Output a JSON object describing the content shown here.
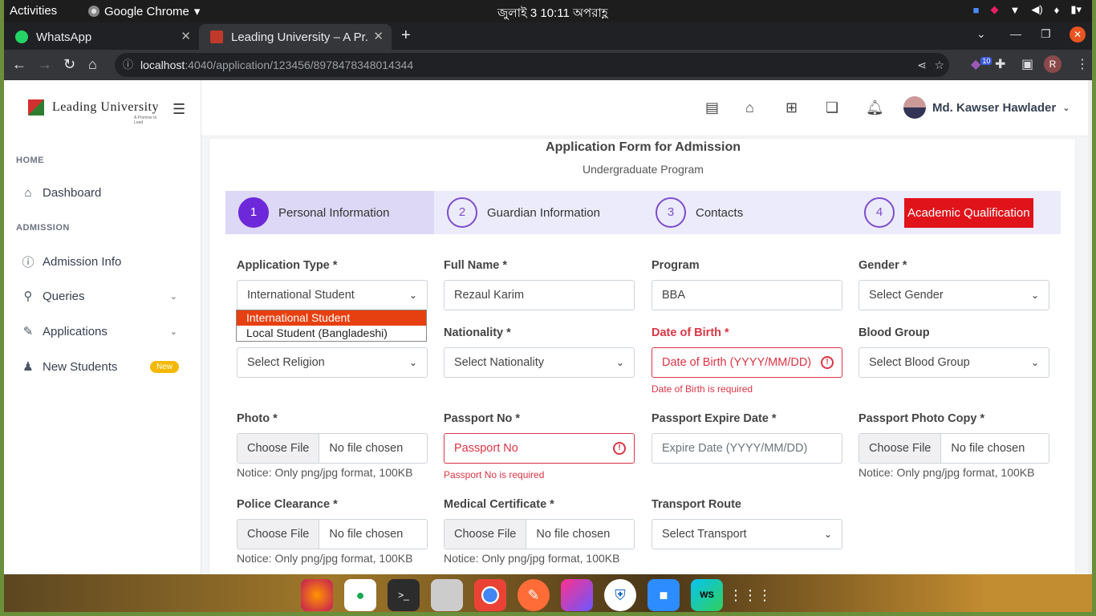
{
  "os": {
    "activities": "Activities",
    "app_name": "Google Chrome",
    "clock": "জুলাই 3  10:11 অপরাহ্ণ"
  },
  "browser": {
    "tabs": [
      {
        "title": "WhatsApp",
        "favicon": "whatsapp-icon",
        "color": "#25d366"
      },
      {
        "title": "Leading University – A Pr...",
        "favicon": "leading-university-icon",
        "color": "#c0392b"
      }
    ],
    "url_host": "localhost",
    "url_path": ":4040/application/123456/8978478348014344",
    "extension_badge": "10",
    "profile_initial": "R"
  },
  "sidebar": {
    "logo_text": "Leading University",
    "logo_tagline": "A Promise to Lead",
    "sections": [
      {
        "title": "HOME"
      },
      {
        "title": "ADMISSION"
      }
    ],
    "items": [
      {
        "label": "Dashboard",
        "icon": "home-icon"
      },
      {
        "label": "Admission Info",
        "icon": "info-icon"
      },
      {
        "label": "Queries",
        "icon": "search-icon"
      },
      {
        "label": "Applications",
        "icon": "pencil-icon"
      },
      {
        "label": "New Students",
        "icon": "user-plus-icon",
        "badge": "New"
      }
    ]
  },
  "header": {
    "user_name": "Md. Kawser Hawlader"
  },
  "form": {
    "title": "Application Form for Admission",
    "subtitle": "Undergraduate Program",
    "steps": [
      {
        "num": "1",
        "label": "Personal Information"
      },
      {
        "num": "2",
        "label": "Guardian Information"
      },
      {
        "num": "3",
        "label": "Contacts"
      },
      {
        "num": "4",
        "label": "Academic Qualification"
      }
    ],
    "fields": {
      "application_type": {
        "label": "Application Type *",
        "value": "International Student"
      },
      "full_name": {
        "label": "Full Name *",
        "value": "Rezaul Karim"
      },
      "program": {
        "label": "Program",
        "value": "BBA"
      },
      "gender": {
        "label": "Gender *",
        "value": "Select Gender"
      },
      "religion": {
        "value": "Select Religion"
      },
      "nationality": {
        "label": "Nationality *",
        "value": "Select Nationality"
      },
      "dob": {
        "label": "Date of Birth *",
        "placeholder": "Date of Birth (YYYY/MM/DD)",
        "error": "Date of Birth is required"
      },
      "blood_group": {
        "label": "Blood Group",
        "value": "Select Blood Group"
      },
      "photo": {
        "label": "Photo *"
      },
      "passport_no": {
        "label": "Passport No *",
        "placeholder": "Passport No",
        "error": "Passport No is required"
      },
      "passport_expire": {
        "label": "Passport Expire Date *",
        "placeholder": "Expire Date (YYYY/MM/DD)"
      },
      "passport_copy": {
        "label": "Passport Photo Copy *"
      },
      "police": {
        "label": "Police Clearance *"
      },
      "medical": {
        "label": "Medical Certificate *"
      },
      "transport": {
        "label": "Transport Route",
        "value": "Select Transport"
      }
    },
    "file_button": "Choose File",
    "file_none": "No file chosen",
    "notice": "Notice: Only png/jpg format, 100KB",
    "dropdown_options": [
      "International Student",
      "Local Student (Bangladeshi)"
    ]
  }
}
